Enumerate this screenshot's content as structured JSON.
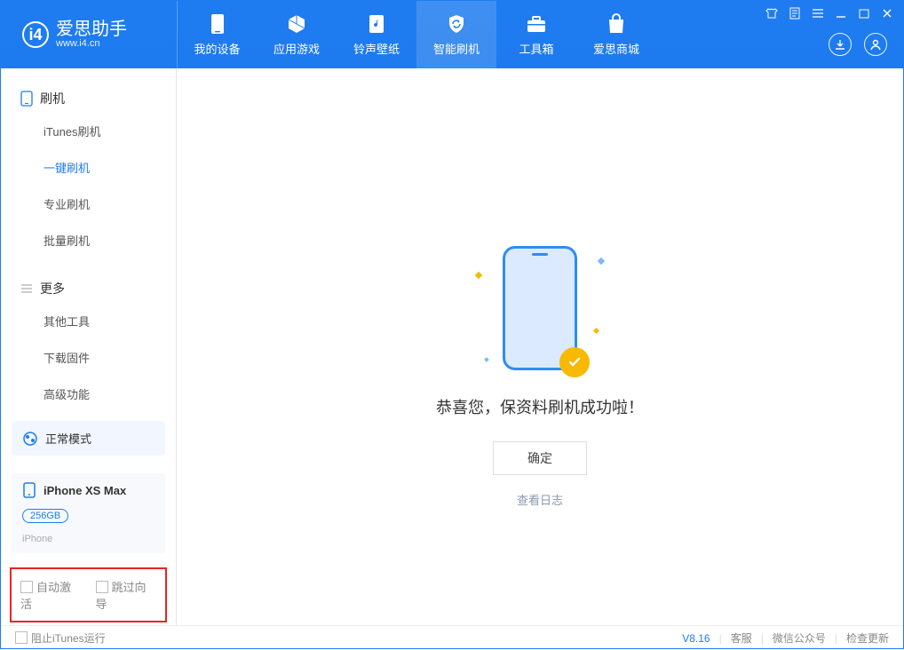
{
  "app": {
    "name": "爱思助手",
    "domain": "www.i4.cn"
  },
  "nav": {
    "items": [
      {
        "label": "我的设备"
      },
      {
        "label": "应用游戏"
      },
      {
        "label": "铃声壁纸"
      },
      {
        "label": "智能刷机"
      },
      {
        "label": "工具箱"
      },
      {
        "label": "爱思商城"
      }
    ]
  },
  "sidebar": {
    "sections": [
      {
        "title": "刷机",
        "items": [
          "iTunes刷机",
          "一键刷机",
          "专业刷机",
          "批量刷机"
        ]
      },
      {
        "title": "更多",
        "items": [
          "其他工具",
          "下载固件",
          "高级功能"
        ]
      }
    ],
    "mode_card": "正常模式",
    "device": {
      "name": "iPhone XS Max",
      "storage": "256GB",
      "type": "iPhone"
    },
    "options": {
      "auto_activate": "自动激活",
      "skip_guide": "跳过向导"
    }
  },
  "main": {
    "success_msg": "恭喜您，保资料刷机成功啦！",
    "ok_btn": "确定",
    "log_link": "查看日志"
  },
  "footer": {
    "block_itunes": "阻止iTunes运行",
    "version": "V8.16",
    "support": "客服",
    "wechat": "微信公众号",
    "update": "检查更新"
  }
}
